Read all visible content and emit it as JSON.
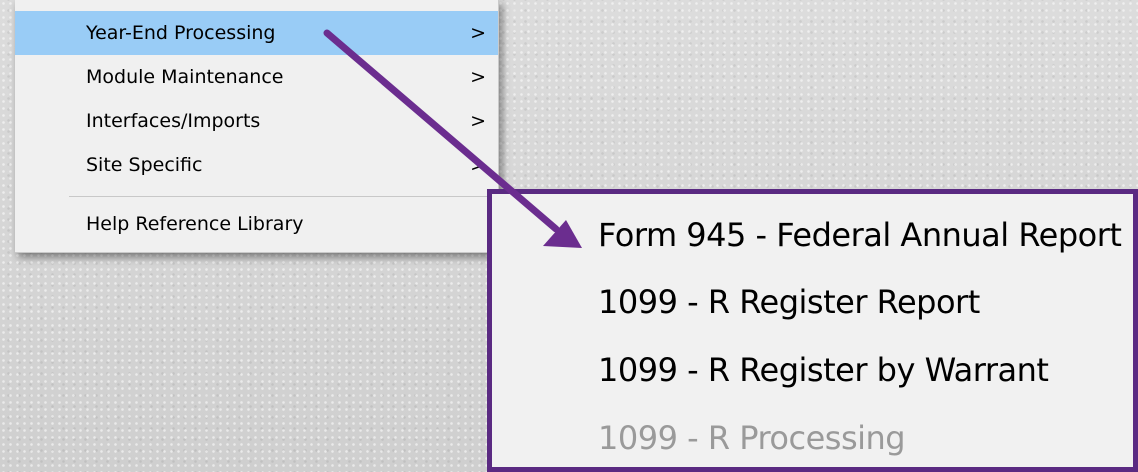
{
  "menu": {
    "items": [
      {
        "label": "Year-End Processing",
        "has_submenu": true,
        "highlighted": true
      },
      {
        "label": "Module Maintenance",
        "has_submenu": true
      },
      {
        "label": "Interfaces/Imports",
        "has_submenu": true
      },
      {
        "label": "Site Specific",
        "has_submenu": true
      },
      {
        "label": "Help Reference Library",
        "has_submenu": false
      }
    ],
    "submenu_glyph": ">"
  },
  "submenu_callout": {
    "items": [
      {
        "label": "Form 945 - Federal Annual Report",
        "enabled": true
      },
      {
        "label": "1099 - R Register Report",
        "enabled": true
      },
      {
        "label": "1099 - R Register by Warrant",
        "enabled": true
      },
      {
        "label": "1099 - R Processing",
        "enabled": false
      }
    ]
  },
  "colors": {
    "highlight": "#99ccf6",
    "callout_border": "#5a2a82",
    "arrow": "#6b2d8f",
    "disabled_text": "#9a9a9a"
  },
  "icons": {
    "pointer": "arrow-pointer-icon"
  }
}
